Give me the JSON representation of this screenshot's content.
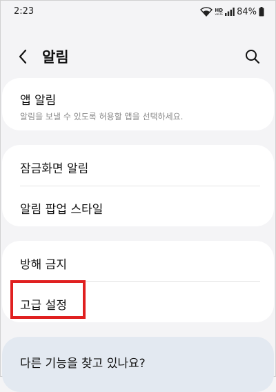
{
  "status_bar": {
    "time": "2:23",
    "network_label": "HD",
    "network_sub": "voLTE",
    "battery": "84%"
  },
  "header": {
    "title": "알림"
  },
  "sections": [
    {
      "items": [
        {
          "label": "앱 알림",
          "description": "알림을 보낼 수 있도록 허용할 앱을 선택하세요."
        }
      ]
    },
    {
      "items": [
        {
          "label": "잠금화면 알림"
        },
        {
          "label": "알림 팝업 스타일"
        }
      ]
    },
    {
      "items": [
        {
          "label": "방해 금지"
        },
        {
          "label": "고급 설정",
          "highlighted": true
        }
      ]
    }
  ],
  "suggestion": {
    "title": "다른 기능을 찾고 있나요?"
  },
  "highlight_color": "#e02020"
}
